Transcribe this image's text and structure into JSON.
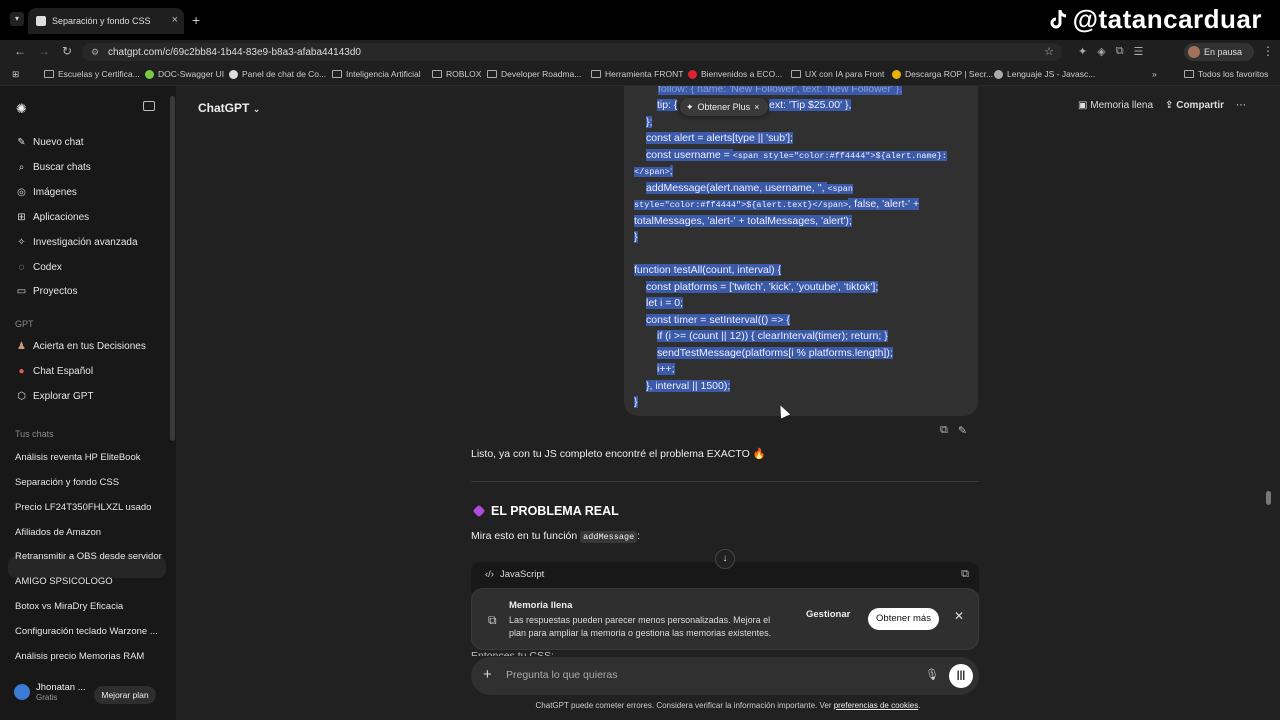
{
  "watermark": "@tatancarduar",
  "browser": {
    "tab_title": "Separación y fondo CSS",
    "url": "chatgpt.com/c/69c2bb84-1b44-83e9-b8a3-afaba44143d0",
    "profile_label": "En pausa",
    "bookmarks": [
      "Escuelas y Certifica...",
      "DOC-Swagger UI",
      "Panel de chat de Co...",
      "Inteligencia Artificial",
      "ROBLOX",
      "Developer Roadma...",
      "Herramienta FRONT",
      "Bienvenidos a ECO...",
      "UX con IA para Front",
      "Descarga ROP | Secr...",
      "Lenguaje JS - Javasc..."
    ],
    "all_bookmarks": "Todos los favoritos"
  },
  "sidebar": {
    "nav": [
      "Nuevo chat",
      "Buscar chats",
      "Imágenes",
      "Aplicaciones",
      "Investigación avanzada",
      "Codex",
      "Proyectos"
    ],
    "gpt_section": "GPT",
    "gpts": [
      "Acierta en tus Decisiones",
      "Chat Español",
      "Explorar GPT"
    ],
    "chats_section": "Tus chats",
    "chats": [
      "Análisis reventa HP EliteBook",
      "Separación y fondo CSS",
      "Precio LF24T350FHLXZL usado",
      "Afiliados de Amazon",
      "Retransmitir a OBS desde servidor",
      "AMIGO SPSICOLOGO",
      "Botox vs MiraDry Eficacia",
      "Configuración teclado Warzone ...",
      "Análisis precio Memorias RAM"
    ],
    "user_name": "Jhonatan ...",
    "user_plan": "Gratis",
    "upgrade": "Mejorar plan"
  },
  "header": {
    "model": "ChatGPT",
    "memory_full": "Memoria llena",
    "share": "Compartir"
  },
  "code": {
    "l1": "follow: { name: 'New Follower', text: 'New Follower' },",
    "l2a": "tip: {",
    "l2b": "ext: 'Tip $25.00' },",
    "l3": "};",
    "l4": "const alert = alerts[type || 'sub'];",
    "l5a": "const username = ",
    "l5b": "<span style=\"color:#ff4444\">${alert.name}:",
    "l6a": "</span>",
    "l6b": ";",
    "l7a": "addMessage(alert.name, username, '', ",
    "l7b": "<span",
    "l8a": "style=\"color:#ff4444\">${alert.text}</span>",
    "l8b": ", false, 'alert-' +",
    "l9": "totalMessages, 'alert-' + totalMessages, 'alert');",
    "l10": "}",
    "l11": "function testAll(count, interval) {",
    "l12": "const platforms = ['twitch', 'kick', 'youtube', 'tiktok'];",
    "l13": "let i = 0;",
    "l14": "const timer = setInterval(() => {",
    "l15": "if (i >= (count || 12)) { clearInterval(timer); return; }",
    "l16": "sendTestMessage(platforms[i % platforms.length]);",
    "l17": "i++;",
    "l18": "}, interval || 1500);",
    "l19": "}"
  },
  "obtener_plus": "Obtener Plus",
  "reply": {
    "intro": "Listo, ya con tu JS completo encontré el problema EXACTO 🔥",
    "heading": "EL PROBLEMA REAL",
    "mira_pre": "Mira esto en tu función",
    "mira_code": "addMessage",
    "mira_post": ":",
    "code_lang": "JavaScript",
    "entonces": "Entonces tu CSS:"
  },
  "memory_banner": {
    "title": "Memoria llena",
    "desc": "Las respuestas pueden parecer menos personalizadas. Mejora el plan para ampliar la memoria o gestiona las memorias existentes.",
    "manage": "Gestionar",
    "get_more": "Obtener más"
  },
  "composer": {
    "placeholder": "Pregunta lo que quieras"
  },
  "footer": {
    "text": "ChatGPT puede cometer errores. Considera verificar la información importante. Ver ",
    "link": "preferencias de cookies",
    "end": "."
  }
}
